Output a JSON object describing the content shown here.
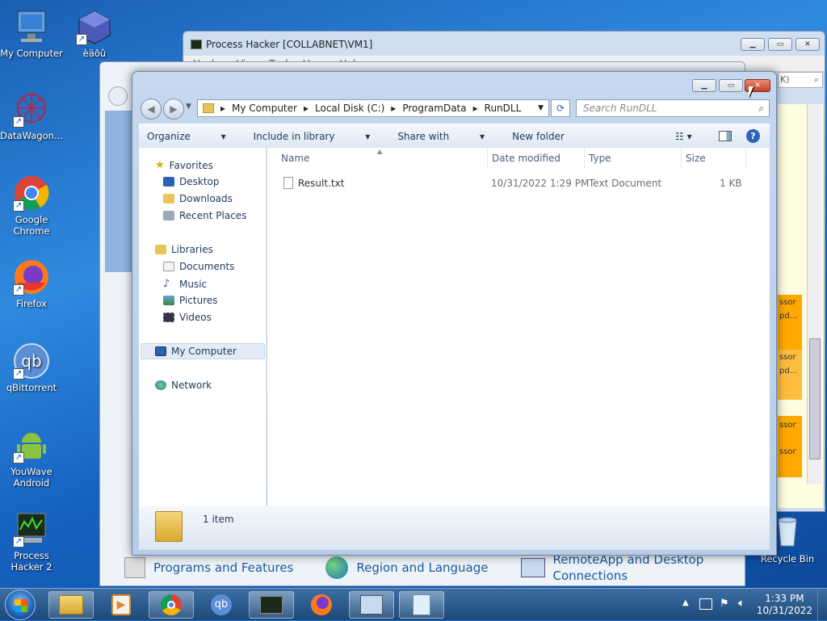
{
  "desktop": {
    "icons": [
      {
        "label": "My Computer",
        "icon": "computer-icon"
      },
      {
        "label": "èäõû",
        "icon": "cube-icon"
      },
      {
        "label": "DataWagon...",
        "icon": "network-sphere-icon"
      },
      {
        "label": "Google Chrome",
        "icon": "chrome-icon"
      },
      {
        "label": "Firefox",
        "icon": "firefox-icon"
      },
      {
        "label": "qBittorrent",
        "icon": "qbittorrent-icon"
      },
      {
        "label": "YouWave Android",
        "icon": "android-icon"
      },
      {
        "label": "Process Hacker 2",
        "icon": "process-hacker-icon"
      },
      {
        "label": "Recycle Bin",
        "icon": "recycle-bin-icon"
      }
    ]
  },
  "process_hacker": {
    "title": "Process Hacker [COLLABNET\\VM1]",
    "menu": [
      "Hacker",
      "View",
      "Tools",
      "Users",
      "Help"
    ],
    "fragments": [
      "ssor",
      "pd...",
      "ssor",
      "pd...",
      "ssor",
      "ssor"
    ],
    "search_tail": "K)"
  },
  "control_panel": {
    "links": [
      "Programs and Features",
      "Region and Language",
      "RemoteApp and Desktop Connections"
    ]
  },
  "explorer": {
    "breadcrumb": [
      "My Computer",
      "Local Disk (C:)",
      "ProgramData",
      "RunDLL"
    ],
    "search_placeholder": "Search RunDLL",
    "toolbar": {
      "organize": "Organize",
      "include": "Include in library",
      "share": "Share with",
      "new_folder": "New folder"
    },
    "nav": {
      "favorites": "Favorites",
      "desktop": "Desktop",
      "downloads": "Downloads",
      "recent": "Recent Places",
      "libraries": "Libraries",
      "documents": "Documents",
      "music": "Music",
      "pictures": "Pictures",
      "videos": "Videos",
      "computer": "My Computer",
      "network": "Network"
    },
    "columns": {
      "name": "Name",
      "date": "Date modified",
      "type": "Type",
      "size": "Size"
    },
    "files": [
      {
        "name": "Result.txt",
        "date": "10/31/2022 1:29 PM",
        "type": "Text Document",
        "size": "1 KB"
      }
    ],
    "status": "1 item"
  },
  "taskbar": {
    "time": "1:33 PM",
    "date": "10/31/2022"
  },
  "colors": {
    "accent": "#1a5a9c",
    "close_red": "#d9472b",
    "orange": "#ffa800"
  }
}
